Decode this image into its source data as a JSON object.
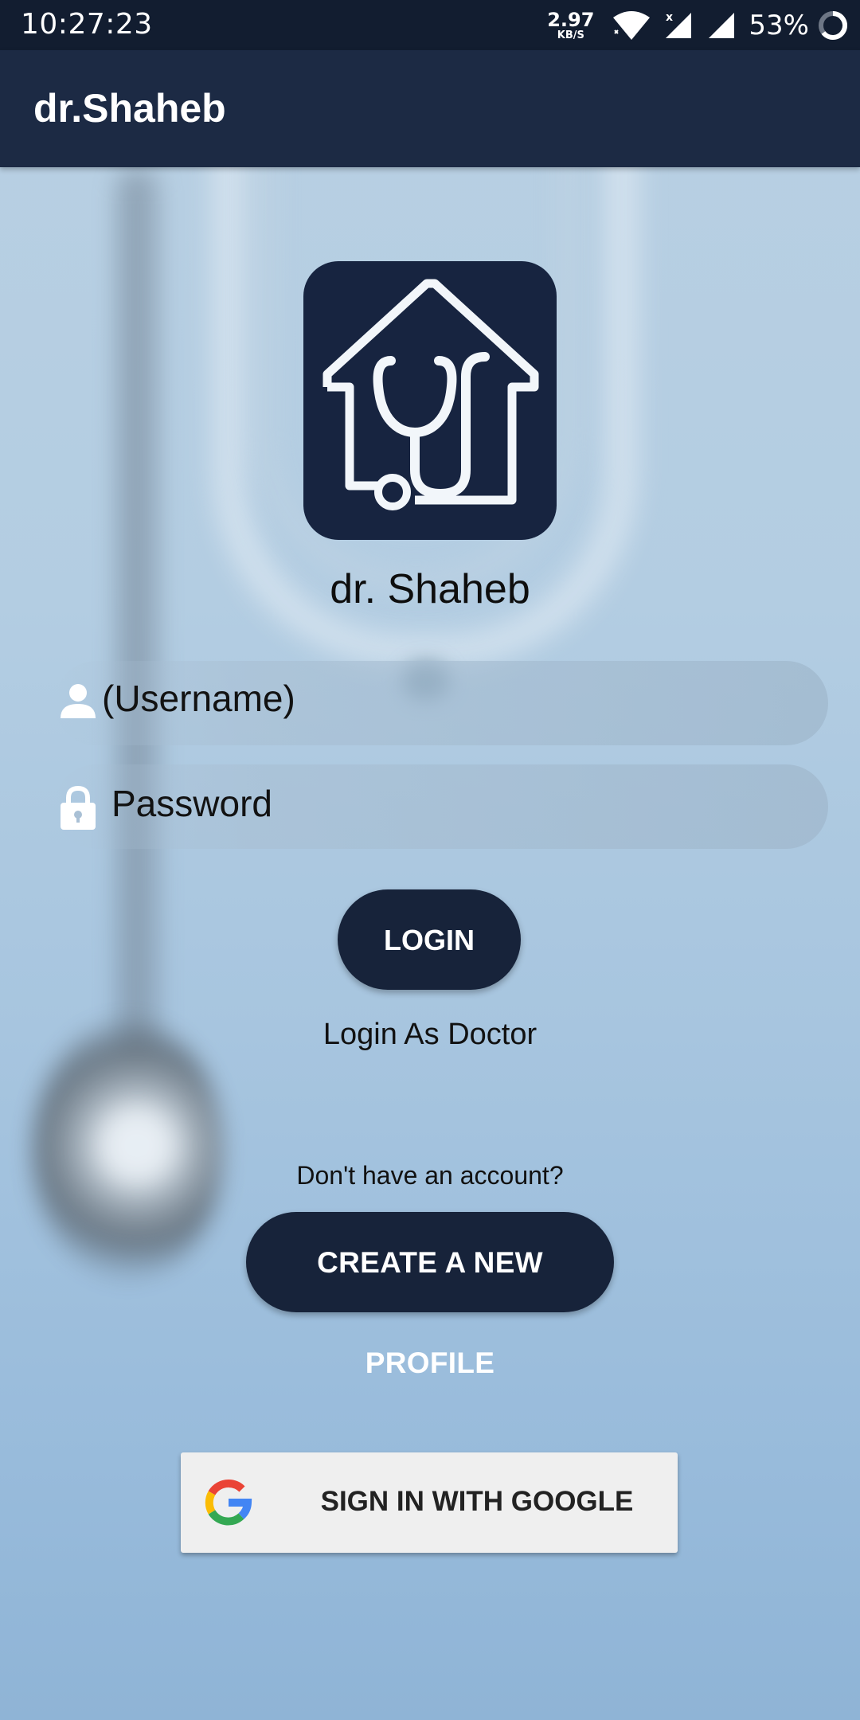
{
  "status_bar": {
    "time": "10:27:23",
    "net_speed_value": "2.97",
    "net_speed_unit": "KB/S",
    "battery": "53%",
    "icons": [
      "wifi-icon",
      "signal-icon",
      "signal-icon",
      "battery-icon"
    ]
  },
  "app_bar": {
    "title": "dr.Shaheb"
  },
  "logo": {
    "name": "dr. Shaheb",
    "icon": "house-stethoscope-logo"
  },
  "login_form": {
    "username_placeholder": "(Username)",
    "password_placeholder": "Password",
    "login_button": "LOGIN",
    "doctor_login_link": "Login As Doctor"
  },
  "signup": {
    "prompt": "Don't have an account?",
    "create_button": "CREATE A NEW PROFILE"
  },
  "google": {
    "label": "SIGN IN WITH GOOGLE",
    "icon": "google-g-icon"
  },
  "colors": {
    "status_bar": "#121d30",
    "app_bar": "#1c2a44",
    "button": "#17233a",
    "logo_bg": "#172440",
    "google_button_bg": "#efefef"
  }
}
